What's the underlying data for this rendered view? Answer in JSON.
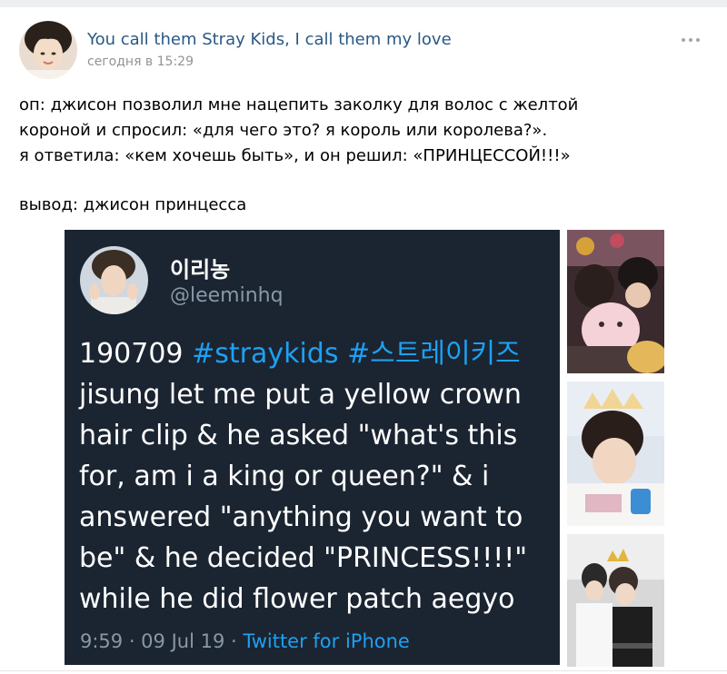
{
  "post": {
    "group_name": "You call them Stray Kids, I call them my love",
    "time": "сегодня в 15:29",
    "text_lines": [
      "оп: джисон позволил мне нацепить заколку для волос с желтой",
      "короной и спросил: «для чего это? я король или королева?».",
      "я ответила: «кем хочешь быть», и он решил: «ПРИНЦЕССОЙ!!!»",
      "вывод: джисон принцесса"
    ],
    "more_icon": "more-dots-icon"
  },
  "tweet": {
    "display_name": "이리농",
    "handle": "@leeminhq",
    "date_code": "190709",
    "hashtag1": "#straykids",
    "hashtag2": "#스트레이키즈",
    "body_lines": [
      "jisung let me put a yellow crown",
      "hair clip & he asked \"what's this",
      "for, am i a king or queen?\"  & i",
      "answered \"anything you want to",
      "be\" & he decided \"PRINCESS!!!!\"",
      "while he did flower patch aegyo"
    ],
    "timestamp": "9:59 · 09 Jul 19 · ",
    "source": "Twitter for iPhone"
  },
  "colors": {
    "link": "#2a5885",
    "muted": "#939393",
    "tweet_bg": "#1b2431",
    "twitter_blue": "#1da1f2"
  }
}
